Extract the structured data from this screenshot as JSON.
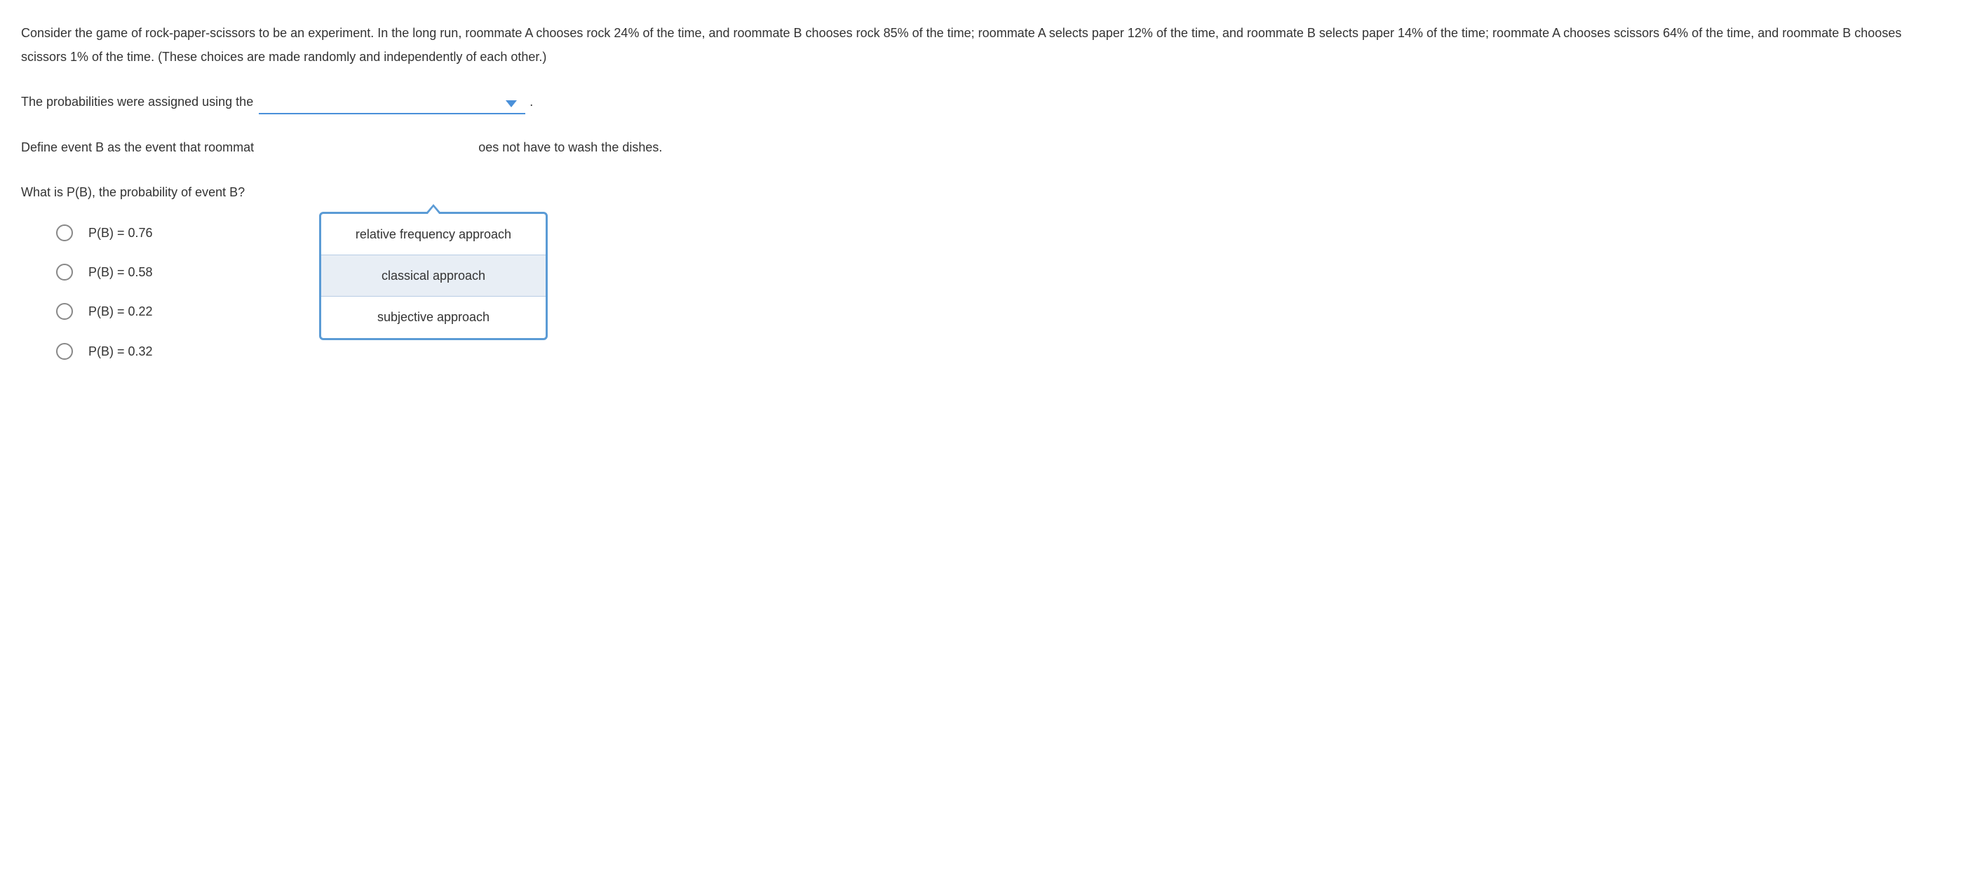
{
  "question": {
    "intro": "Consider the game of rock-paper-scissors to be an experiment. In the long run, roommate A chooses rock 24% of the time, and roommate B chooses rock 85% of the time; roommate A selects paper 12% of the time, and roommate B selects paper 14% of the time; roommate A chooses scissors 64% of the time, and roommate B chooses scissors 1% of the time. (These choices are made randomly and independently of each other.)",
    "prompt_prefix": "The probabilities were assigned using the",
    "prompt_suffix": ".",
    "define_text_left": "Define event B as the event that roommat",
    "define_text_right": "oes not have to wash the dishes.",
    "sub_question": "What is P(B), the probability of event B?"
  },
  "dropdown": {
    "options": [
      "relative frequency approach",
      "classical approach",
      "subjective approach"
    ],
    "hovered_index": 1
  },
  "answers": [
    "P(B) = 0.76",
    "P(B) = 0.58",
    "P(B) = 0.22",
    "P(B) = 0.32"
  ]
}
